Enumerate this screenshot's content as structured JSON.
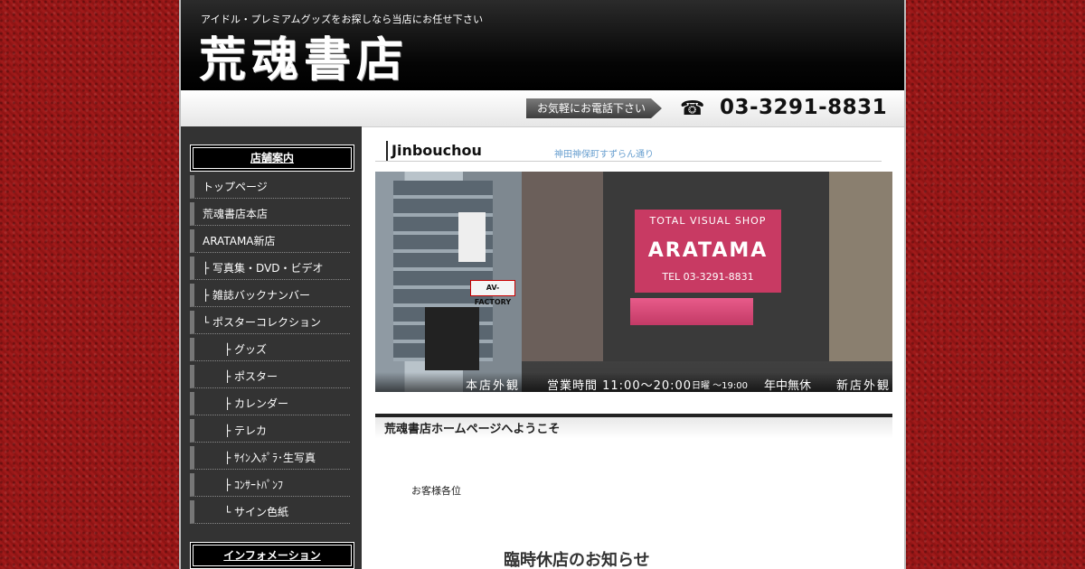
{
  "header": {
    "tagline": "アイドル・プレミアムグッズをお探しなら当店にお任せ下さい",
    "logo": "荒魂書店"
  },
  "phonebar": {
    "call_label": "お気軽にお電話下さい",
    "phone_icon": "☎",
    "phone_number": "03-3291-8831"
  },
  "sidebar": {
    "store_heading": "店舗案内",
    "items": [
      {
        "label": "トップページ"
      },
      {
        "label": "荒魂書店本店"
      },
      {
        "label": "ARATAMA新店"
      },
      {
        "label": "├ 写真集・DVD・ビデオ"
      },
      {
        "label": "├ 雑誌バックナンバー"
      },
      {
        "label": "└ ポスターコレクション"
      },
      {
        "label": "　　├ グッズ"
      },
      {
        "label": "　　├ ポスター"
      },
      {
        "label": "　　├ カレンダー"
      },
      {
        "label": "　　├ テレカ"
      },
      {
        "label": "　　├ ｻｲﾝ入ﾎﾟﾗ･生写真"
      },
      {
        "label": "　　├ ｺﾝｻｰﾄﾊﾟﾝﾌ"
      },
      {
        "label": "　　└ サイン色紙"
      }
    ],
    "info_heading": "インフォメーション"
  },
  "main": {
    "section_title": "Jinbouchou",
    "section_subtitle": "神田神保町すずらん通り",
    "photo": {
      "sign_line1": "TOTAL VISUAL SHOP",
      "sign_line2": "ARATAMA",
      "sign_line3": "TEL 03-3291-8831",
      "left_sign": "AV-FACTORY",
      "caption_honten": "本店外観",
      "caption_hours": "営業時間 11:00～20:00",
      "caption_sunday": "日曜 ～19:00",
      "caption_open": "年中無休",
      "caption_shinten": "新店外観"
    },
    "welcome": "荒魂書店ホームページへようこそ",
    "customer": "お客様各位",
    "notice_title": "臨時休店のお知らせ"
  },
  "colors": {
    "background_red": "#9b1818",
    "header_black": "#000000",
    "sidebar_dark": "#333333",
    "sign_pink": "#c83a63",
    "subtitle_blue": "#6aa0d0"
  }
}
